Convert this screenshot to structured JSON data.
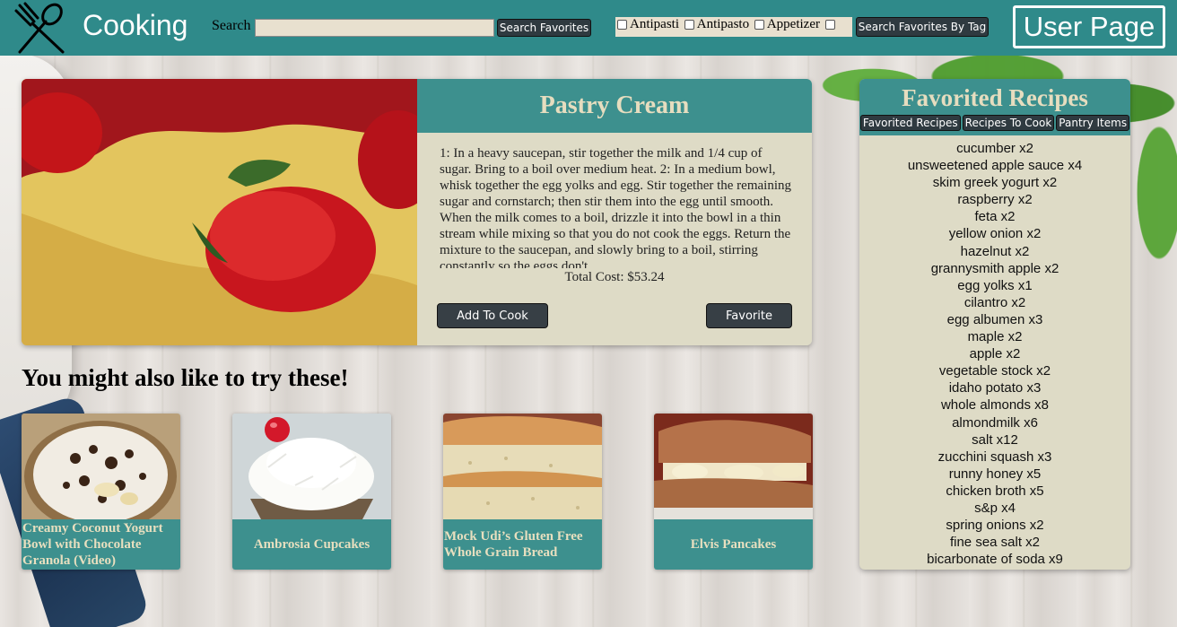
{
  "header": {
    "brand": "Cooking",
    "search_label": "Search",
    "search_placeholder": "",
    "search_favorites_button": "Search Favorites",
    "tags": [
      "Antipasti",
      "Antipasto",
      "Appetizer"
    ],
    "search_by_tag_button": "Search Favorites By Tag",
    "user_page_button": "User Page"
  },
  "recipe": {
    "title": "Pastry Cream",
    "instructions": "1: In a heavy saucepan, stir together the milk and 1/4 cup of sugar. Bring to a boil over medium heat. 2: In a medium bowl, whisk together the egg yolks and egg. Stir together the remaining sugar and cornstarch; then stir them into the egg until smooth. When the milk comes to a boil, drizzle it into the bowl in a thin stream while mixing so that you do not cook the eggs. Return the mixture to the saucepan, and slowly bring to a boil, stirring constantly so the eggs don't",
    "total_cost": "Total Cost: $53.24",
    "add_to_cook_button": "Add To Cook",
    "favorite_button": "Favorite"
  },
  "suggestions": {
    "heading": "You might also like to try these!",
    "items": [
      {
        "title": "Creamy Coconut Yogurt Bowl with Chocolate Granola (Video)"
      },
      {
        "title": "Ambrosia Cupcakes"
      },
      {
        "title": "Mock Udi’s Gluten Free Whole Grain Bread"
      },
      {
        "title": "Elvis Pancakes"
      }
    ]
  },
  "favorites_panel": {
    "title": "Favorited Recipes",
    "tabs": [
      "Favorited Recipes",
      "Recipes To Cook",
      "Pantry Items"
    ],
    "pantry_items": [
      "cucumber x2",
      "unsweetened apple sauce x4",
      "skim greek yogurt x2",
      "raspberry x2",
      "feta x2",
      "yellow onion x2",
      "hazelnut x2",
      "grannysmith apple x2",
      "egg yolks x1",
      "cilantro x2",
      "egg albumen x3",
      "maple x2",
      "apple x2",
      "vegetable stock x2",
      "idaho potato x3",
      "whole almonds x8",
      "almondmilk x6",
      "salt x12",
      "zucchini squash x3",
      "runny honey x5",
      "chicken broth x5",
      "s&p x4",
      "spring onions x2",
      "fine sea salt x2",
      "bicarbonate of soda x9"
    ]
  },
  "colors": {
    "header_bg": "#2f8a8a",
    "panel_title_bg": "#3d908e",
    "panel_bg": "#dedbc6",
    "button_bg": "#2f3a40"
  }
}
